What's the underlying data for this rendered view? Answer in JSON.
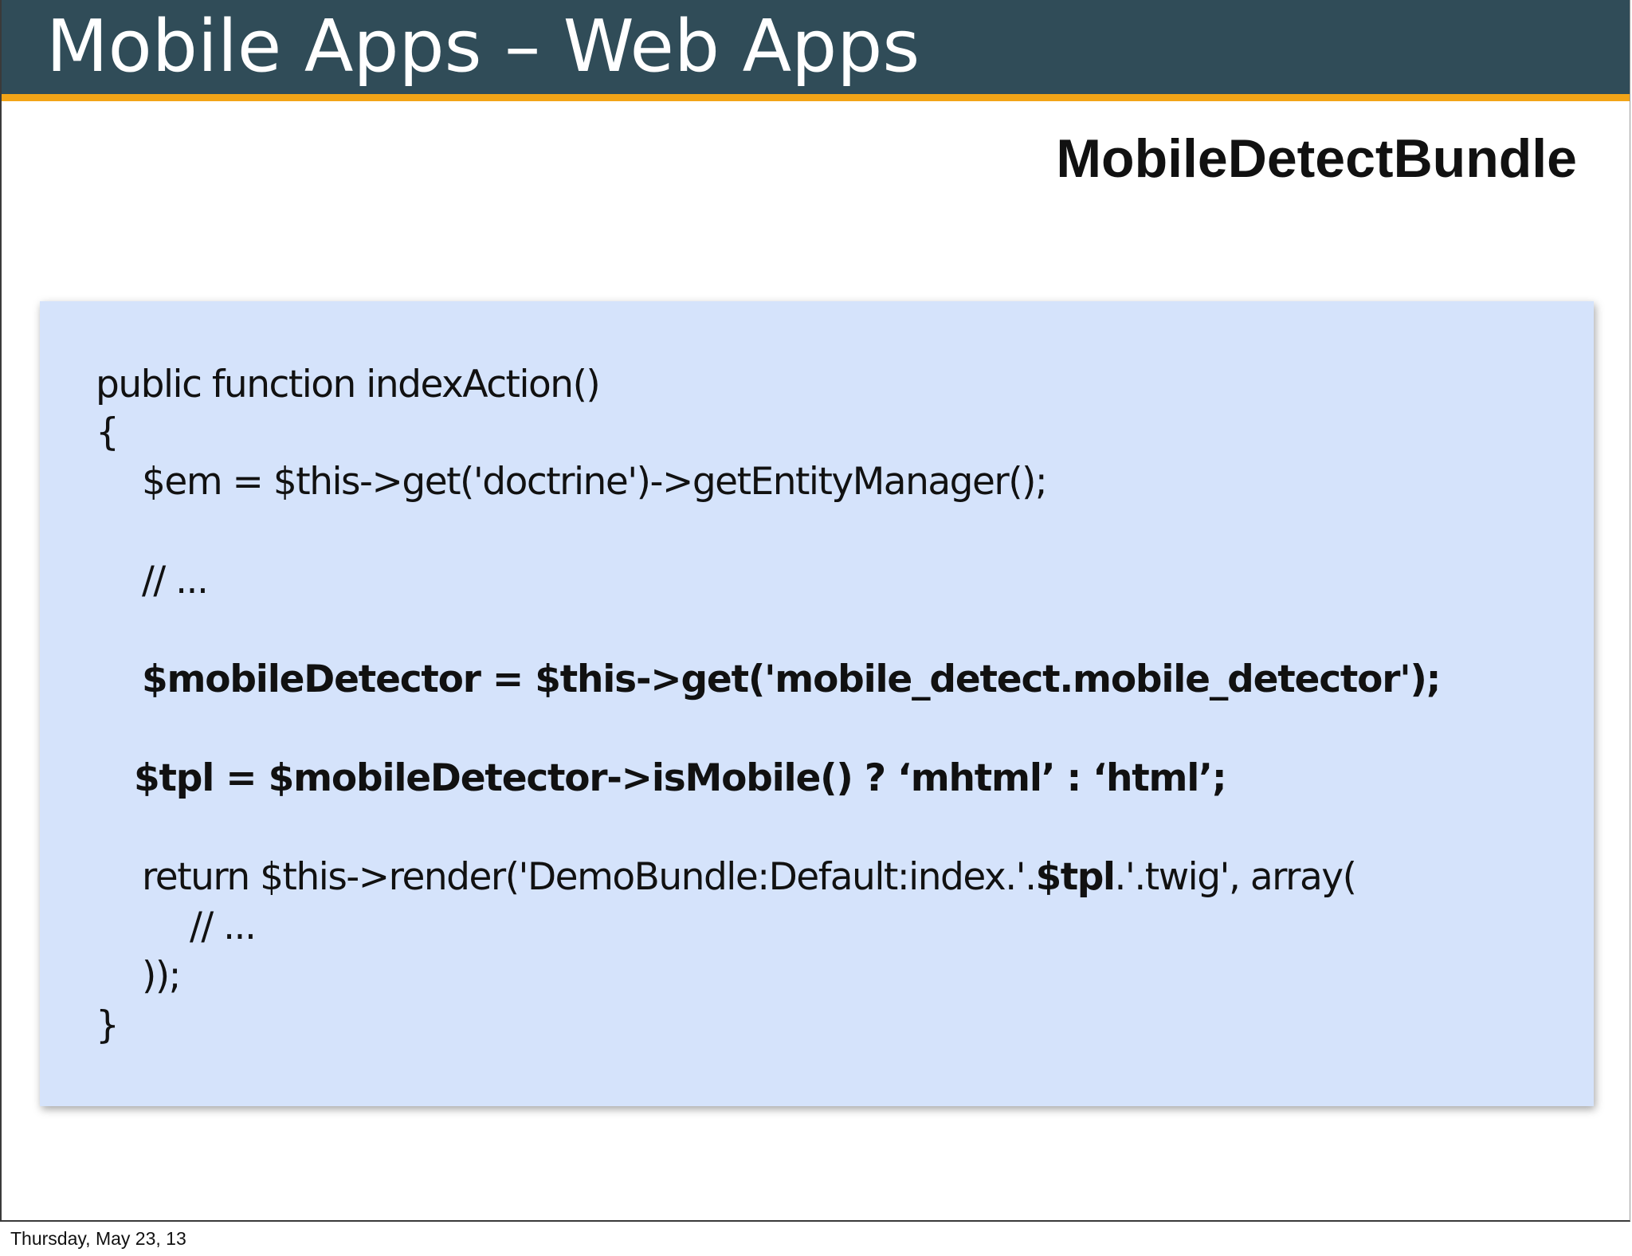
{
  "slide": {
    "title": "Mobile Apps – Web Apps",
    "subtitle": "MobileDetectBundle",
    "code": {
      "line1": "public function indexAction()",
      "line2": "{",
      "line3": "$em = $this->get('doctrine')->getEntityManager();",
      "line4": "// ...",
      "line5": "$mobileDetector = $this->get('mobile_detect.mobile_detector');",
      "line6": "$tpl = $mobileDetector->isMobile() ? ‘mhtml’ : ‘html’;",
      "line7_before": "return $this->render('DemoBundle:Default:index.'.",
      "line7_bold": "$tpl",
      "line7_after": ".'.twig', array(",
      "line8": "// ...",
      "line9": "));",
      "line10": "}"
    }
  },
  "footer": {
    "date": "Thursday, May 23, 13"
  },
  "colors": {
    "header_background": "#304c58",
    "header_accent": "#f2a417",
    "code_background": "#d5e3fb"
  }
}
